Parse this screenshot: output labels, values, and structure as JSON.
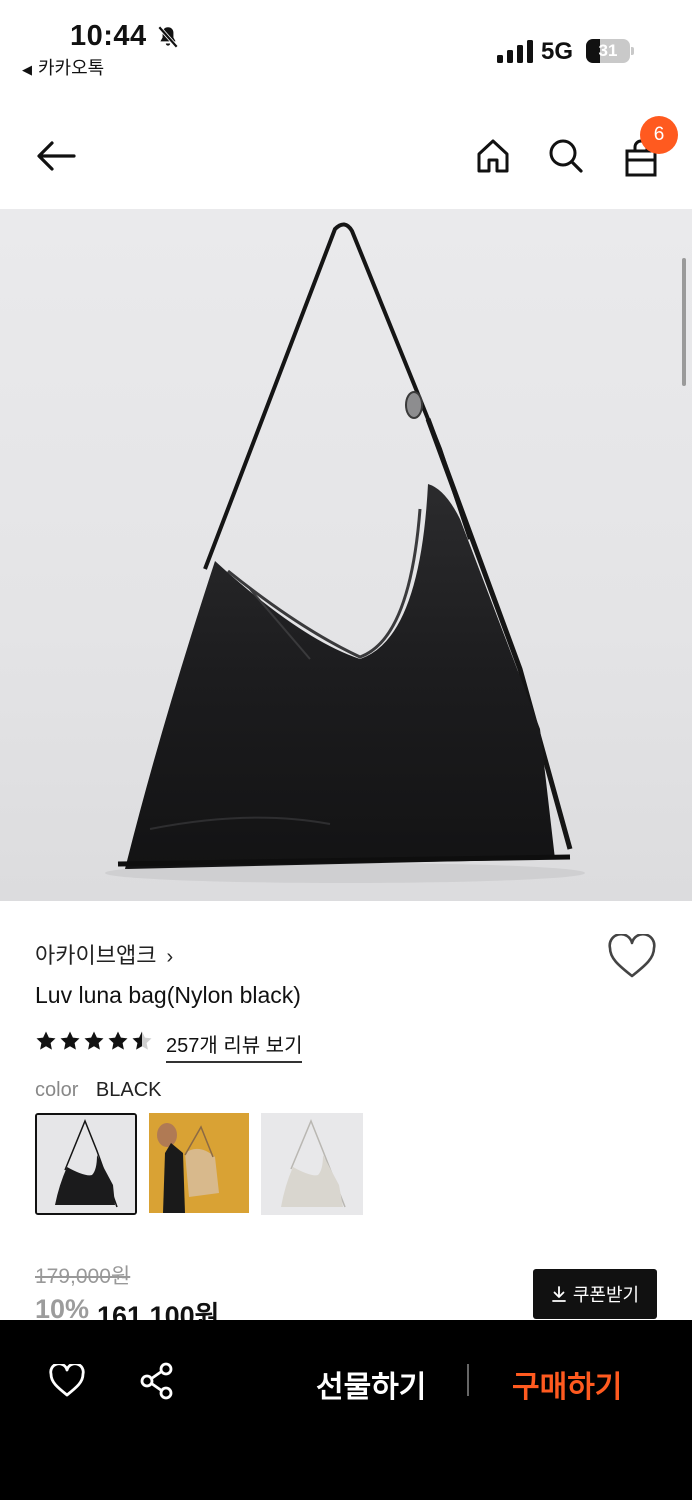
{
  "status_bar": {
    "time": "10:44",
    "back_app": "카카오톡",
    "network": "5G",
    "battery": "31",
    "battery_level": 0.31
  },
  "header": {
    "cart_count": "6"
  },
  "product": {
    "brand": "아카이브앱크",
    "brand_chevron": "›",
    "name": "Luv luna bag(Nylon black)",
    "rating": 4.5,
    "reviews_label": "257개 리뷰 보기",
    "color_label": "color",
    "color_value": "BLACK",
    "original_price": "179,000원",
    "discount": "10%",
    "price": "161,100원",
    "coupon_label": "쿠폰받기",
    "coupon_icon": "download-icon"
  },
  "bottom_bar": {
    "gift_label": "선물하기",
    "buy_label": "구매하기"
  },
  "colors": {
    "accent": "#ff5a1f",
    "dark": "#111111"
  }
}
